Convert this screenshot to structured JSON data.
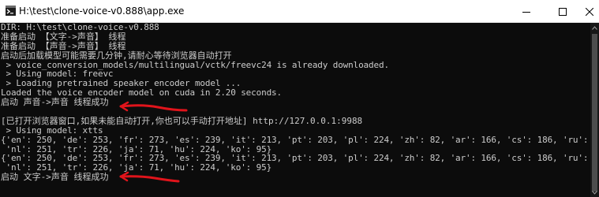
{
  "window": {
    "title": "H:\\test\\clone-voice-v0.888\\app.exe",
    "minimize_glyph": "—",
    "maximize_glyph": "☐",
    "close_glyph": "✕"
  },
  "colors": {
    "console_bg": "#0c0c0c",
    "console_text": "#cccccc",
    "annotation_red": "#e0141b"
  },
  "console": {
    "lines": [
      "DIR: H:\\test\\clone-voice-v0.888",
      "准备启动 【文字->声音】 线程",
      "准备启动 【声音->声音】 线程",
      "启动后加载模型可能需要几分钟,请耐心等待浏览器自动打开",
      " > voice_conversion_models/multilingual/vctk/freevc24 is already downloaded.",
      " > Using model: freevc",
      " > Loading pretrained speaker encoder model ...",
      "Loaded the voice encoder model on cuda in 2.20 seconds.",
      "启动 声音->声音 线程成功",
      "",
      "[已打开浏览器窗口,如果未能自动打开,你也可以手动打开地址] http://127.0.0.1:9988",
      " > Using model: xtts",
      "{'en': 250, 'de': 253, 'fr': 273, 'es': 239, 'it': 213, 'pt': 203, 'pl': 224, 'zh': 82, 'ar': 166, 'cs': 186, 'ru': 182,",
      " 'nl': 251, 'tr': 226, 'ja': 71, 'hu': 224, 'ko': 95}",
      "{'en': 250, 'de': 253, 'fr': 273, 'es': 239, 'it': 213, 'pt': 203, 'pl': 224, 'zh': 82, 'ar': 166, 'cs': 186, 'ru': 182,",
      " 'nl': 251, 'tr': 226, 'ja': 71, 'hu': 224, 'ko': 95}",
      "启动 文字->声音 线程成功"
    ]
  }
}
